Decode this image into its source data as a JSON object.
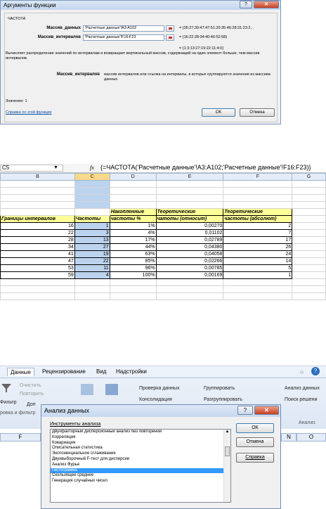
{
  "dialog1": {
    "title": "Аргументы функции",
    "function_name": "ЧАСТОТА",
    "arg1_label": "Массив_данных",
    "arg1_value": "'Расчетные данные'!A3:A102",
    "arg1_result": "= {35:27:39:47:47:51:20:35:46:28:31:23:2...",
    "arg2_label": "Массив_интервалов",
    "arg2_value": "'Расчетные данные'!F16:F23",
    "arg2_result": "= {16:22:28:34:40:46:52:58}",
    "total_result": "= {1:3:13:27:19:22:11:4:0}",
    "description": "Вычисляет распределение значений по интервалам и возвращает вертикальный массив, содержащий на один элемент больше, чем массив интервалов.",
    "detail_label": "Массив_интервалов",
    "detail_text": "массив интервалов или ссылка на интервалы, в которых группируются значения из массива данных.",
    "value_label": "Значение:  1",
    "help_link": "Справка по этой функции",
    "ok": "ОК",
    "cancel": "Отмена",
    "help_icon": "?",
    "close_icon": "✕"
  },
  "formula_bar": {
    "cell_ref": "C5",
    "fx": "fx",
    "formula": "{=ЧАСТОТА('Расчетные данные'!A3:A102;'Расчетные данные'!F16:F23)}"
  },
  "sheet": {
    "columns": [
      "B",
      "C",
      "D",
      "E",
      "F",
      "G"
    ],
    "header1": [
      "",
      "",
      "Накопленные",
      "Теоретические",
      "Теоретические"
    ],
    "header2": [
      "Границы интервалов",
      "Частоты",
      "частоты %",
      "чатоты (относит)",
      "частоты (абсолют)"
    ],
    "rows": [
      [
        "16",
        "1",
        "1%",
        "0,00270",
        "2"
      ],
      [
        "22",
        "3",
        "4%",
        "0,01102",
        "7"
      ],
      [
        "28",
        "13",
        "17%",
        "0,02789",
        "17"
      ],
      [
        "34",
        "27",
        "44%",
        "0,04380",
        "26"
      ],
      [
        "41",
        "19",
        "63%",
        "0,04058",
        "24"
      ],
      [
        "47",
        "22",
        "85%",
        "0,02266",
        "14"
      ],
      [
        "53",
        "11",
        "96%",
        "0,00785",
        "5"
      ],
      [
        "59",
        "4",
        "100%",
        "0,00169",
        "1"
      ]
    ]
  },
  "ribbon": {
    "tabs": [
      "Данные",
      "Рецензирование",
      "Вид",
      "Надстройки"
    ],
    "clear": "Очистить",
    "reapply": "Повторить",
    "filter": "Фильтр",
    "advanced": "Доп",
    "sort_group": "ровка и фильтр",
    "what_if": "Проверка данных",
    "consolidate": "Консолидация",
    "group": "Группировать",
    "ungroup": "Разгруппировать",
    "analysis": "Анализ данных",
    "solver": "Поиск решени",
    "analysis_group": "Анализ"
  },
  "grid2": {
    "columns": [
      "F",
      "N",
      "O"
    ]
  },
  "dialog2": {
    "title": "Анализ данных",
    "list_label": "Инструменты анализа",
    "items": [
      "Двухфакторный дисперсионный анализ без повторений",
      "Корреляция",
      "Ковариация",
      "Описательная статистика",
      "Экспоненциальное сглаживание",
      "Двухвыборочный F-тест для дисперсии",
      "Анализ Фурье",
      "Гистограмма",
      "Скользящее среднее",
      "Генерация случайных чисел"
    ],
    "selected_index": 7,
    "ok": "ОК",
    "cancel": "Отмена",
    "help": "Справка",
    "help_icon": "?",
    "close_icon": "✕"
  }
}
